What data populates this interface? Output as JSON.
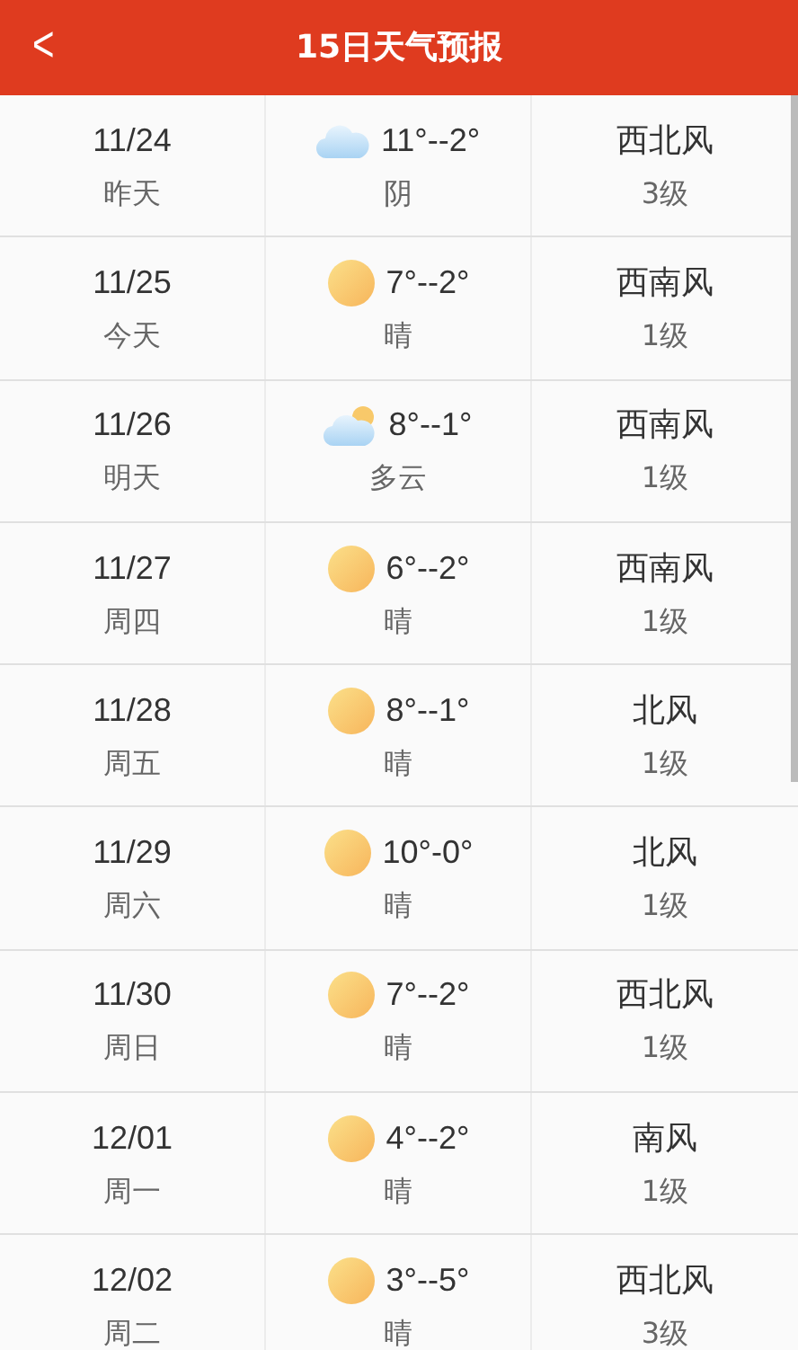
{
  "header": {
    "back": "<",
    "title": "15日天气预报"
  },
  "days": [
    {
      "date": "11/24",
      "day": "昨天",
      "kind": "cloudy",
      "temp": "11°--2°",
      "weather": "阴",
      "wind": "西北风",
      "level": "3级"
    },
    {
      "date": "11/25",
      "day": "今天",
      "kind": "sunny",
      "temp": "7°--2°",
      "weather": "晴",
      "wind": "西南风",
      "level": "1级"
    },
    {
      "date": "11/26",
      "day": "明天",
      "kind": "partly",
      "temp": "8°--1°",
      "weather": "多云",
      "wind": "西南风",
      "level": "1级"
    },
    {
      "date": "11/27",
      "day": "周四",
      "kind": "sunny",
      "temp": "6°--2°",
      "weather": "晴",
      "wind": "西南风",
      "level": "1级"
    },
    {
      "date": "11/28",
      "day": "周五",
      "kind": "sunny",
      "temp": "8°--1°",
      "weather": "晴",
      "wind": "北风",
      "level": "1级"
    },
    {
      "date": "11/29",
      "day": "周六",
      "kind": "sunny",
      "temp": "10°-0°",
      "weather": "晴",
      "wind": "北风",
      "level": "1级"
    },
    {
      "date": "11/30",
      "day": "周日",
      "kind": "sunny",
      "temp": "7°--2°",
      "weather": "晴",
      "wind": "西北风",
      "level": "1级"
    },
    {
      "date": "12/01",
      "day": "周一",
      "kind": "sunny",
      "temp": "4°--2°",
      "weather": "晴",
      "wind": "南风",
      "level": "1级"
    },
    {
      "date": "12/02",
      "day": "周二",
      "kind": "sunny",
      "temp": "3°--5°",
      "weather": "晴",
      "wind": "西北风",
      "level": "3级"
    }
  ]
}
